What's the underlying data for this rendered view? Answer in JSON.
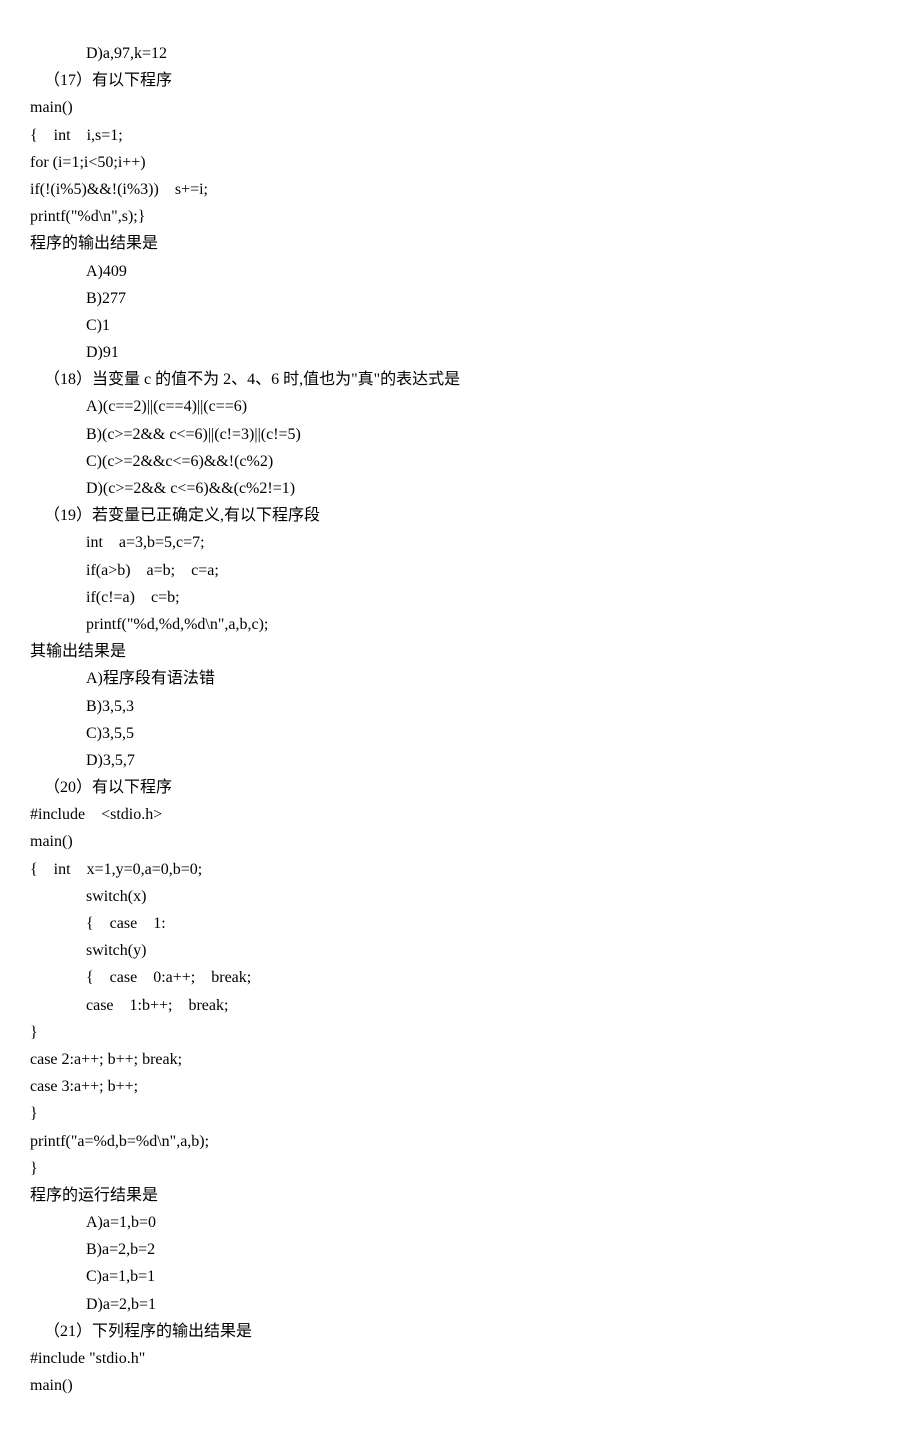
{
  "lines": [
    {
      "cls": "indent1",
      "text": "D)a,97,k=12"
    },
    {
      "cls": "indent-q",
      "text": "（17）有以下程序"
    },
    {
      "cls": "",
      "text": "main()"
    },
    {
      "cls": "",
      "text": "{    int    i,s=1;"
    },
    {
      "cls": "",
      "text": "for (i=1;i<50;i++)"
    },
    {
      "cls": "",
      "text": "if(!(i%5)&&!(i%3))    s+=i;"
    },
    {
      "cls": "",
      "text": "printf(\"%d\\n\",s);}"
    },
    {
      "cls": "",
      "text": "程序的输出结果是"
    },
    {
      "cls": "indent1",
      "text": "A)409"
    },
    {
      "cls": "indent1",
      "text": "B)277"
    },
    {
      "cls": "indent1",
      "text": "C)1"
    },
    {
      "cls": "indent1",
      "text": "D)91"
    },
    {
      "cls": "indent-q",
      "text": "（18）当变量 c 的值不为 2、4、6 时,值也为\"真\"的表达式是"
    },
    {
      "cls": "indent1",
      "text": "A)(c==2)||(c==4)||(c==6)"
    },
    {
      "cls": "indent1",
      "text": "B)(c>=2&& c<=6)||(c!=3)||(c!=5)"
    },
    {
      "cls": "indent1",
      "text": "C)(c>=2&&c<=6)&&!(c%2)"
    },
    {
      "cls": "indent1",
      "text": "D)(c>=2&& c<=6)&&(c%2!=1)"
    },
    {
      "cls": "indent-q",
      "text": "（19）若变量已正确定义,有以下程序段"
    },
    {
      "cls": "indent1",
      "text": "int    a=3,b=5,c=7;"
    },
    {
      "cls": "indent1",
      "text": "if(a>b)    a=b;    c=a;"
    },
    {
      "cls": "indent1",
      "text": "if(c!=a)    c=b;"
    },
    {
      "cls": "indent1",
      "text": "printf(\"%d,%d,%d\\n\",a,b,c);"
    },
    {
      "cls": "",
      "text": "其输出结果是"
    },
    {
      "cls": "indent1",
      "text": "A)程序段有语法错"
    },
    {
      "cls": "indent1",
      "text": "B)3,5,3"
    },
    {
      "cls": "indent1",
      "text": "C)3,5,5"
    },
    {
      "cls": "indent1",
      "text": "D)3,5,7"
    },
    {
      "cls": "indent-q",
      "text": "（20）有以下程序"
    },
    {
      "cls": "",
      "text": "#include    <stdio.h>"
    },
    {
      "cls": "",
      "text": "main()"
    },
    {
      "cls": "",
      "text": "{    int    x=1,y=0,a=0,b=0;"
    },
    {
      "cls": "indent1",
      "text": "switch(x)"
    },
    {
      "cls": "indent1",
      "text": "{    case    1:"
    },
    {
      "cls": "indent1",
      "text": "switch(y)"
    },
    {
      "cls": "indent1",
      "text": "{    case    0:a++;    break;"
    },
    {
      "cls": "indent1",
      "text": "case    1:b++;    break;"
    },
    {
      "cls": "",
      "text": "}"
    },
    {
      "cls": "",
      "text": "case 2:a++; b++; break;"
    },
    {
      "cls": "",
      "text": "case 3:a++; b++;"
    },
    {
      "cls": "",
      "text": "}"
    },
    {
      "cls": "",
      "text": "printf(\"a=%d,b=%d\\n\",a,b);"
    },
    {
      "cls": "",
      "text": "}"
    },
    {
      "cls": "",
      "text": "程序的运行结果是"
    },
    {
      "cls": "indent1",
      "text": "A)a=1,b=0"
    },
    {
      "cls": "indent1",
      "text": "B)a=2,b=2"
    },
    {
      "cls": "indent1",
      "text": "C)a=1,b=1"
    },
    {
      "cls": "indent1",
      "text": "D)a=2,b=1"
    },
    {
      "cls": "indent-q",
      "text": "（21）下列程序的输出结果是"
    },
    {
      "cls": "",
      "text": "#include \"stdio.h\""
    },
    {
      "cls": "",
      "text": "main()"
    }
  ]
}
